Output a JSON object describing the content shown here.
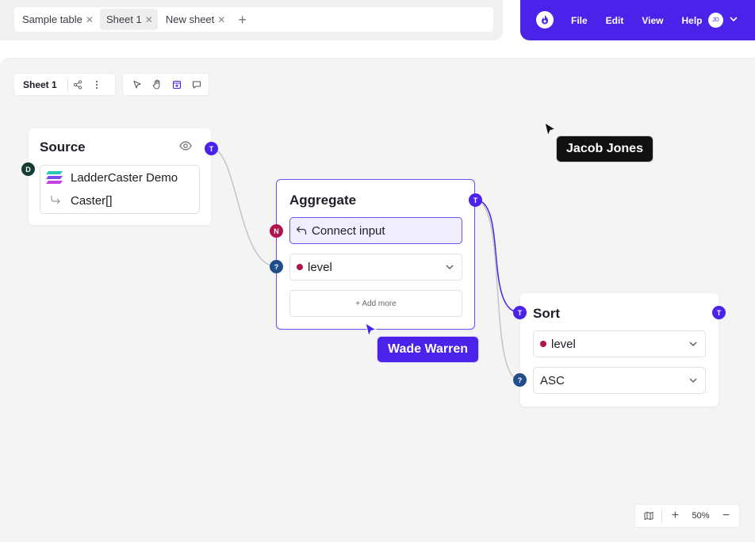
{
  "tabs": [
    {
      "label": "Sample table",
      "active": false
    },
    {
      "label": "Sheet 1",
      "active": true
    },
    {
      "label": "New sheet",
      "active": false
    }
  ],
  "tab_add_icon": "plus-icon",
  "appbar": {
    "logo_icon": "flame-logo",
    "menu": [
      "File",
      "Edit",
      "View",
      "Help"
    ],
    "avatar_initials": "JD",
    "accent": "#4a22ea"
  },
  "toolbar": {
    "sheet_name": "Sheet 1",
    "icons": [
      "share-icon",
      "more-vertical-icon"
    ],
    "tools": [
      "pointer-icon",
      "hand-icon",
      "add-frame-icon",
      "comment-icon"
    ]
  },
  "nodes": {
    "source": {
      "title": "Source",
      "visibility_icon": "eye-icon",
      "input_badge": "D",
      "output_badge": "T",
      "dataset": "LadderCaster Demo",
      "path": "Caster[]"
    },
    "aggregate": {
      "title": "Aggregate",
      "output_badge": "T",
      "connect_badge": "N",
      "connect_label": "Connect input",
      "field_badge": "?",
      "field_value": "level",
      "add_more": "+ Add more"
    },
    "sort": {
      "title": "Sort",
      "input_badge": "T",
      "output_badge": "T",
      "field_value": "level",
      "order_badge": "?",
      "order_value": "ASC"
    }
  },
  "cursors": [
    {
      "name": "Jacob Jones",
      "color": "#111111"
    },
    {
      "name": "Wade Warren",
      "color": "#4a22ea"
    }
  ],
  "zoom": {
    "map_icon": "map-icon",
    "value": "50%",
    "plus": "+",
    "minus": "−"
  },
  "colors": {
    "dot_level": "#b0144f",
    "badge_T": "#4a22ea",
    "badge_Q": "#1f4e8a",
    "badge_N": "#b0144f",
    "badge_D": "#163b35"
  }
}
